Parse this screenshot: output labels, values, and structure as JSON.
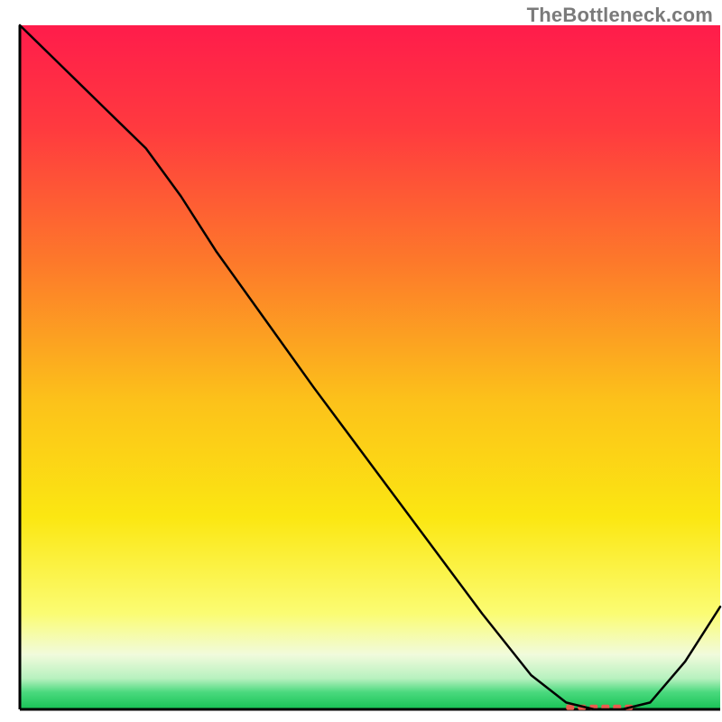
{
  "attribution": "TheBottleneck.com",
  "chart_data": {
    "type": "line",
    "title": "",
    "xlabel": "",
    "ylabel": "",
    "xlim": [
      0,
      100
    ],
    "ylim": [
      0,
      100
    ],
    "grid": false,
    "legend": false,
    "gradient_stops": [
      {
        "offset": 0.0,
        "color": "#ff1c4b"
      },
      {
        "offset": 0.15,
        "color": "#ff3a3f"
      },
      {
        "offset": 0.35,
        "color": "#fd7a2a"
      },
      {
        "offset": 0.55,
        "color": "#fcc21a"
      },
      {
        "offset": 0.72,
        "color": "#fbe712"
      },
      {
        "offset": 0.86,
        "color": "#fbfc73"
      },
      {
        "offset": 0.92,
        "color": "#f1fbdc"
      },
      {
        "offset": 0.955,
        "color": "#b7f1bf"
      },
      {
        "offset": 0.975,
        "color": "#4ad97e"
      },
      {
        "offset": 1.0,
        "color": "#17c255"
      }
    ],
    "series": [
      {
        "name": "bottleneck-curve",
        "x": [
          0,
          6,
          12,
          18,
          23,
          28,
          35,
          42,
          50,
          58,
          66,
          73,
          78,
          82,
          86,
          90,
          95,
          100
        ],
        "y": [
          100,
          94,
          88,
          82,
          75,
          67,
          57,
          47,
          36,
          25,
          14,
          5,
          1,
          0,
          0,
          1,
          7,
          15
        ]
      }
    ],
    "marker": {
      "x_start": 78,
      "x_end": 88,
      "y": 0.3,
      "color": "#e95b4e"
    }
  }
}
